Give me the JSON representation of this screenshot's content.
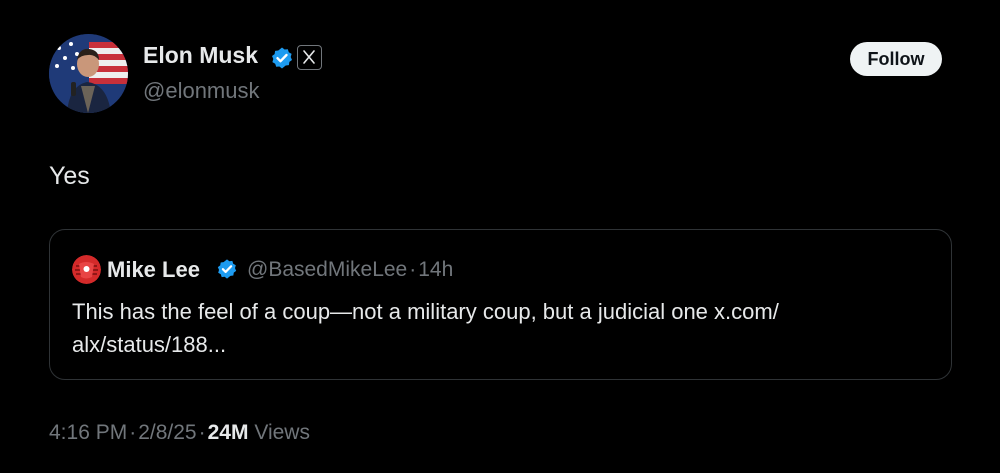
{
  "post": {
    "author": {
      "name": "Elon Musk",
      "handle": "@elonmusk",
      "verified": true,
      "affiliation_badge": "x-logo-icon"
    },
    "follow_label": "Follow",
    "text": "Yes",
    "timestamp": "4:16 PM",
    "date": "2/8/25",
    "views_count": "24M",
    "views_label": "Views"
  },
  "quote": {
    "author": {
      "name": "Mike Lee",
      "handle": "@BasedMikeLee",
      "verified": true
    },
    "separator": "·",
    "age": "14h",
    "text": "This has the feel of a coup—not a military coup, but a judicial one x.com/ alx/status/188..."
  },
  "colors": {
    "background": "#000000",
    "primary_text": "#e7e9ea",
    "secondary_text": "#71767b",
    "verified_blue": "#1d9bf0",
    "follow_button_bg": "#eff3f4",
    "card_border": "#2f3336"
  }
}
